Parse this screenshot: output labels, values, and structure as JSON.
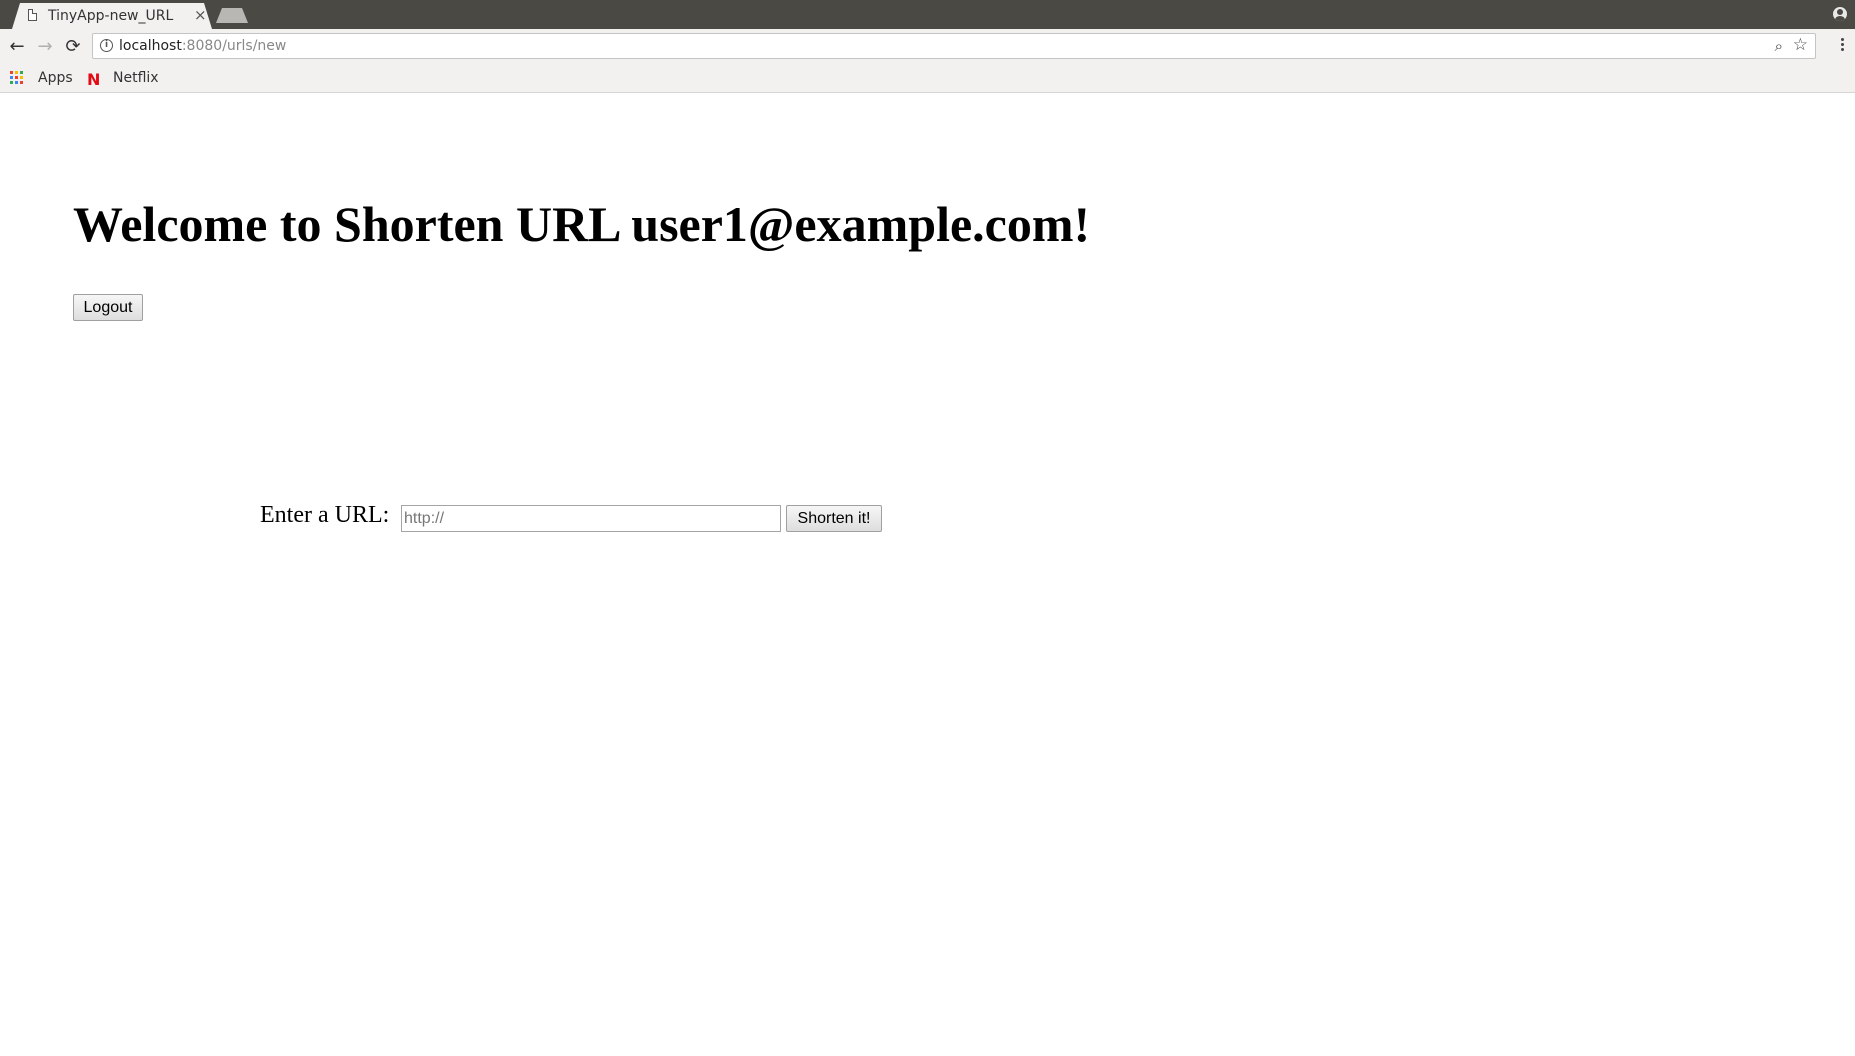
{
  "browser": {
    "tab": {
      "title": "TinyApp-new_URL",
      "close_glyph": "×"
    },
    "toolbar": {
      "back_glyph": "←",
      "forward_glyph": "→",
      "reload_glyph": "⟳",
      "url_host": "localhost",
      "url_rest": ":8080/urls/new",
      "zoom_glyph": "⌕",
      "star_glyph": "☆"
    },
    "bookmarks": {
      "apps_label": "Apps",
      "netflix_logo": "N",
      "netflix_label": "Netflix"
    }
  },
  "page": {
    "heading": "Welcome to Shorten URL user1@example.com!",
    "logout_label": "Logout",
    "form": {
      "label": "Enter a URL:",
      "input_placeholder": "http://",
      "input_value": "",
      "submit_label": "Shorten it!"
    }
  },
  "colors": {
    "tabstrip": "#4a4944",
    "toolbar": "#f2f1f0",
    "netflix_red": "#e50914"
  }
}
